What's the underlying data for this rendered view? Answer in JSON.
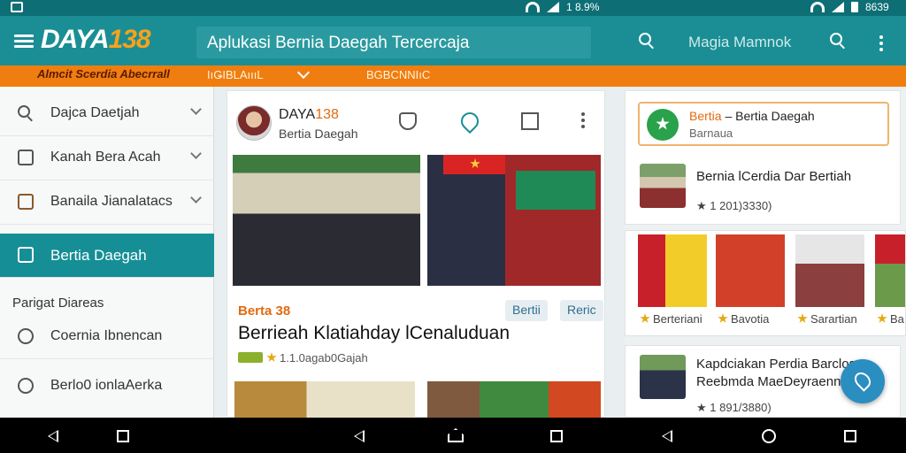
{
  "status_bar": {
    "time_mid": "1 8.9%",
    "time_right": "8639"
  },
  "app_bar": {
    "logo_text": "DAYA",
    "logo_num": "138",
    "title": "Aplukasi Bernia Daegah Tercercaja",
    "search_placeholder": "Magia Mamnok"
  },
  "sub_bar": {
    "tagline": "Almcit Scerdia Abecrrall",
    "tab_1": "IıǤIBLAıııL",
    "tab_2": "BGBCNNIıC"
  },
  "drawer": {
    "items": [
      {
        "label": "Dajca Daetjah",
        "icon": "search-icon"
      },
      {
        "label": "Kanah Bera Acah",
        "icon": "calendar-icon"
      },
      {
        "label": "Banaila Jianalatacs",
        "icon": "folder-icon"
      },
      {
        "label": "Bertia Daegah",
        "icon": "news-icon",
        "active": true
      },
      {
        "label": "Coernia Ibnencan",
        "icon": "search-icon"
      },
      {
        "label": "Berlo0 ionlaAerka",
        "icon": "smile-icon"
      }
    ],
    "section_label": "Parigat Diareas"
  },
  "feed": {
    "source_name": "DAYA",
    "source_num": "138",
    "source_sub": "Bertia Daegah",
    "tag": "Berta 38",
    "chip_1": "Bertii",
    "chip_2": "Reric",
    "title": "Berrieah Klatiahday lCenaluduan",
    "meta": "1.1.0agab0Gajah"
  },
  "right": {
    "highlight_title_accent": "Bertia",
    "highlight_title": "– Bertia Daegah",
    "highlight_sub": "Barnaua",
    "item_1_title": "Bernia lCerdia Dar Bertiah",
    "item_1_meta": "★ 1 201)3330)",
    "strip_captions": [
      "Berteriani",
      "Bavotia",
      "Sarartian",
      "Ba"
    ],
    "item_2_title_1": "Kapdciakan Perdia Barclos",
    "item_2_title_2": "Reebmda MaeDeyraenn",
    "item_2_meta": "★ 1 891/3880)"
  },
  "colors": {
    "app_bar": "#1a8e94",
    "accent_orange": "#f07d0f",
    "active_drawer": "#168e96",
    "fab": "#2b8ec0"
  }
}
